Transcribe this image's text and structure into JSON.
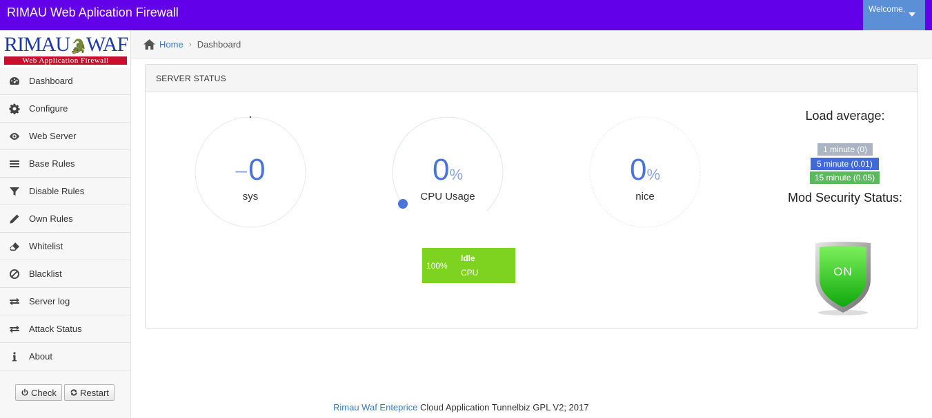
{
  "app": {
    "title": "RIMAU Web Aplication Firewall"
  },
  "user_menu": {
    "label": "Welcome,"
  },
  "logo": {
    "main_left": "RIMAU",
    "main_right": "WAF",
    "sub": "Web Application Firewall"
  },
  "sidebar": {
    "items": [
      {
        "label": "Dashboard",
        "icon": "dashboard-icon"
      },
      {
        "label": "Configure",
        "icon": "gear-icon"
      },
      {
        "label": "Web Server",
        "icon": "eye-icon"
      },
      {
        "label": "Base Rules",
        "icon": "bars-icon"
      },
      {
        "label": "Disable Rules",
        "icon": "filter-icon"
      },
      {
        "label": "Own Rules",
        "icon": "pencil-icon"
      },
      {
        "label": "Whitelist",
        "icon": "eraser-icon"
      },
      {
        "label": "Blacklist",
        "icon": "ban-icon"
      },
      {
        "label": "Server log",
        "icon": "exchange-icon"
      },
      {
        "label": "Attack Status",
        "icon": "exchange-icon"
      },
      {
        "label": "About",
        "icon": "info-icon"
      }
    ],
    "check_label": "Check",
    "restart_label": "Restart"
  },
  "breadcrumb": {
    "home": "Home",
    "current": "Dashboard"
  },
  "panel": {
    "title": "SERVER STATUS"
  },
  "gauges": {
    "sys": {
      "value": "0",
      "label": "sys"
    },
    "cpu": {
      "value": "0",
      "unit": "%",
      "label": "CPU Usage"
    },
    "nice": {
      "value": "0",
      "unit": "%",
      "label": "nice"
    }
  },
  "idle": {
    "percent": "100%",
    "title": "Idle",
    "sub": "CPU"
  },
  "load": {
    "title": "Load average:",
    "items": [
      {
        "label": "1 minute (0)",
        "color": "#aab4c2"
      },
      {
        "label": "5 minute (0.01)",
        "color": "#3f6ad8"
      },
      {
        "label": "15 minute (0.05)",
        "color": "#5cb85c"
      }
    ]
  },
  "mod_security": {
    "title": "Mod Security Status:",
    "status": "ON",
    "color": "#22c41c"
  },
  "footer": {
    "brand": "Rimau Waf Enteprice",
    "text": " Cloud Application Tunnelbiz GPL V2; 2017"
  },
  "colors": {
    "topbar": "#6200ea",
    "accent": "#4a74d9",
    "idle": "#7ed321"
  }
}
